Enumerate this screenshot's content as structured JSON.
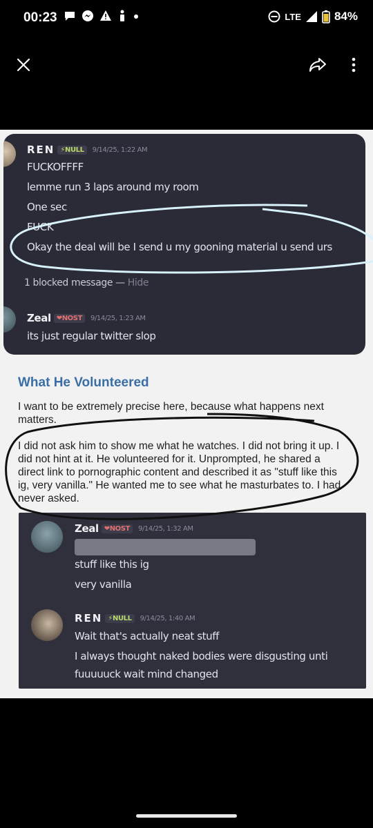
{
  "status_bar": {
    "time": "00:23",
    "network": "LTE",
    "battery": "84%"
  },
  "toolbar": {
    "close_icon": "close-icon",
    "share_icon": "share-icon",
    "more_icon": "more-vert-icon"
  },
  "chat_top": {
    "msg1": {
      "author": "REN",
      "badge": "NULL",
      "timestamp": "9/14/25, 1:22 AM",
      "lines": [
        "FUCKOFFFF",
        "lemme run 3 laps around my room",
        "One sec",
        "FUCK",
        "Okay the deal will be I send u my gooning material u send urs"
      ]
    },
    "blocked": {
      "text": "1 blocked message —",
      "hide": "Hide"
    },
    "msg2": {
      "author": "Zeal",
      "badge": "NOST",
      "timestamp": "9/14/25, 1:23 AM",
      "text": "its just regular twitter slop"
    }
  },
  "document": {
    "heading": "What He Volunteered",
    "para1_lines": [
      "I want to be extremely precise here, because what happens next",
      "matters."
    ],
    "para2_lines": [
      "I did not ask him to show me what he watches. I did not bring it up. I",
      "did not hint at it. He volunteered for it. Unprompted, he shared a",
      "direct link to pornographic content and described it as \"stuff like this",
      "ig, very vanilla.\" He wanted me to see what he masturbates to. I had",
      "never asked."
    ]
  },
  "chat_bottom": {
    "msg1": {
      "author": "Zeal",
      "badge": "NOST",
      "timestamp": "9/14/25, 1:32 AM",
      "lines": [
        "stuff like this ig",
        "very vanilla"
      ]
    },
    "msg2": {
      "author": "REN",
      "badge": "NULL",
      "timestamp": "9/14/25, 1:40 AM",
      "lines": [
        "Wait that's actually neat stuff",
        "I always thought naked bodies were disgusting unti",
        "fuuuuuck wait mind changed"
      ]
    }
  }
}
